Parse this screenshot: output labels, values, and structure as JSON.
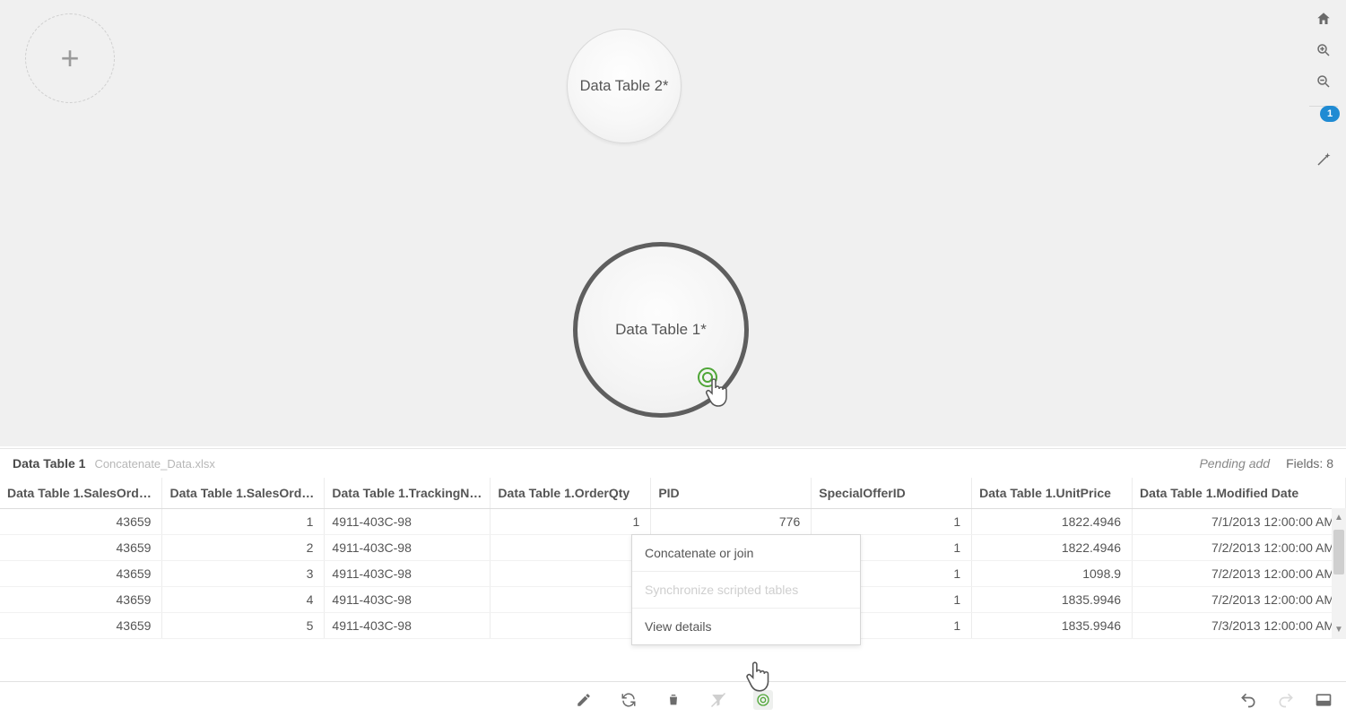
{
  "canvas": {
    "node2_label": "Data Table 2*",
    "node1_label": "Data Table 1*"
  },
  "right_toolbar": {
    "badge_count": "1"
  },
  "table_panel": {
    "title": "Data Table 1",
    "subtitle": "Concatenate_Data.xlsx",
    "pending": "Pending add",
    "fields_label": "Fields: 8"
  },
  "columns": [
    "Data Table 1.SalesOrderID",
    "Data Table 1.SalesOrder...",
    "Data Table 1.TrackingNum...",
    "Data Table 1.OrderQty",
    "PID",
    "SpecialOfferID",
    "Data Table 1.UnitPrice",
    "Data Table 1.Modified Date"
  ],
  "rows": [
    {
      "c0": "43659",
      "c1": "1",
      "c2": "4911-403C-98",
      "c3": "1",
      "c4": "776",
      "c5": "1",
      "c6": "1822.4946",
      "c7": "7/1/2013 12:00:00 AM"
    },
    {
      "c0": "43659",
      "c1": "2",
      "c2": "4911-403C-98",
      "c3": "3",
      "c4": "",
      "c5": "1",
      "c6": "1822.4946",
      "c7": "7/2/2013 12:00:00 AM"
    },
    {
      "c0": "43659",
      "c1": "3",
      "c2": "4911-403C-98",
      "c3": "1",
      "c4": "",
      "c5": "1",
      "c6": "1098.9",
      "c7": "7/2/2013 12:00:00 AM"
    },
    {
      "c0": "43659",
      "c1": "4",
      "c2": "4911-403C-98",
      "c3": "1",
      "c4": "",
      "c5": "1",
      "c6": "1835.9946",
      "c7": "7/2/2013 12:00:00 AM"
    },
    {
      "c0": "43659",
      "c1": "5",
      "c2": "4911-403C-98",
      "c3": "1",
      "c4": "",
      "c5": "1",
      "c6": "1835.9946",
      "c7": "7/3/2013 12:00:00 AM"
    }
  ],
  "context_menu": [
    {
      "label": "Concatenate or join",
      "disabled": false
    },
    {
      "label": "Synchronize scripted tables",
      "disabled": true
    },
    {
      "label": "View details",
      "disabled": false
    }
  ]
}
